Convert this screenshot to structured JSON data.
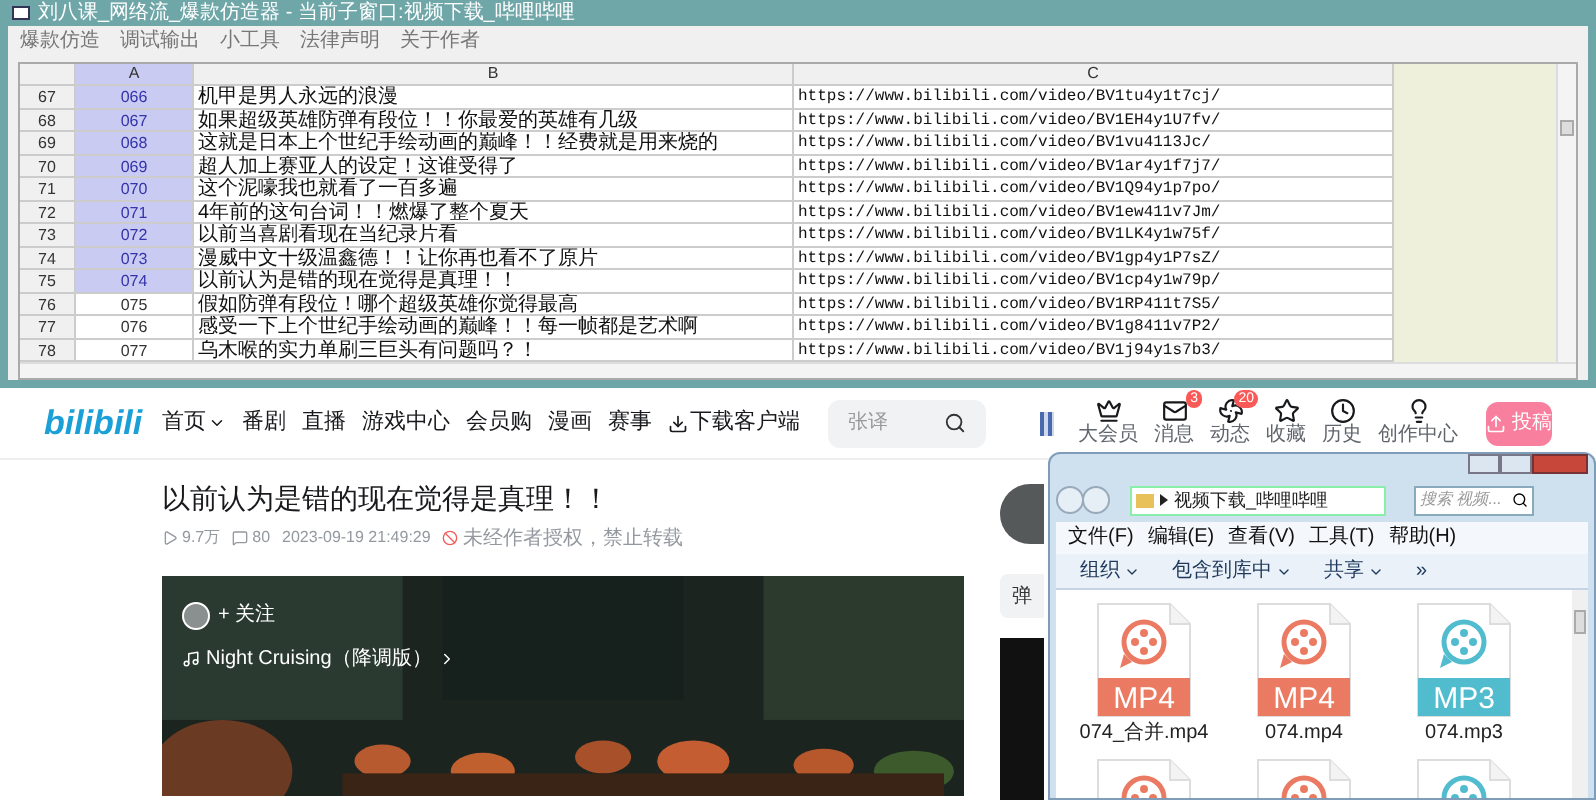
{
  "app": {
    "title": "刘八课_网络流_爆款仿造器 - 当前子窗口:视频下载_哔哩哔哩",
    "menu": [
      "爆款仿造",
      "调试输出",
      "小工具",
      "法律声明",
      "关于作者"
    ],
    "sheet": {
      "columns": [
        {
          "label": "A",
          "selected": true
        },
        {
          "label": "B",
          "selected": false
        },
        {
          "label": "C",
          "selected": false
        }
      ],
      "rows": [
        {
          "number": "67",
          "a": "066",
          "b": "机甲是男人永远的浪漫",
          "c": "https://www.bilibili.com/video/BV1tu4y1t7cj/",
          "selected": true
        },
        {
          "number": "68",
          "a": "067",
          "b": "如果超级英雄防弹有段位！！你最爱的英雄有几级",
          "c": "https://www.bilibili.com/video/BV1EH4y1U7fv/",
          "selected": true
        },
        {
          "number": "69",
          "a": "068",
          "b": "这就是日本上个世纪手绘动画的巅峰！！经费就是用来烧的",
          "c": "https://www.bilibili.com/video/BV1vu4113Jc/",
          "selected": true
        },
        {
          "number": "70",
          "a": "069",
          "b": "超人加上赛亚人的设定！这谁受得了",
          "c": "https://www.bilibili.com/video/BV1ar4y1f7j7/",
          "selected": true
        },
        {
          "number": "71",
          "a": "070",
          "b": "这个泥嚎我也就看了一百多遍",
          "c": "https://www.bilibili.com/video/BV1Q94y1p7po/",
          "selected": true
        },
        {
          "number": "72",
          "a": "071",
          "b": "4年前的这句台词！！燃爆了整个夏天",
          "c": "https://www.bilibili.com/video/BV1ew411v7Jm/",
          "selected": true
        },
        {
          "number": "73",
          "a": "072",
          "b": "以前当喜剧看现在当纪录片看",
          "c": "https://www.bilibili.com/video/BV1LK4y1w75f/",
          "selected": true
        },
        {
          "number": "74",
          "a": "073",
          "b": "漫威中文十级温鑫德！！让你再也看不了原片",
          "c": "https://www.bilibili.com/video/BV1gp4y1P7sZ/",
          "selected": true
        },
        {
          "number": "75",
          "a": "074",
          "b": "以前认为是错的现在觉得是真理！！",
          "c": "https://www.bilibili.com/video/BV1cp4y1w79p/",
          "selected": true
        },
        {
          "number": "76",
          "a": "075",
          "b": "假如防弹有段位！哪个超级英雄你觉得最高",
          "c": "https://www.bilibili.com/video/BV1RP411t7S5/",
          "selected": false
        },
        {
          "number": "77",
          "a": "076",
          "b": "感受一下上个世纪手绘动画的巅峰！！每一帧都是艺术啊",
          "c": "https://www.bilibili.com/video/BV1g8411v7P2/",
          "selected": false
        },
        {
          "number": "78",
          "a": "077",
          "b": "乌木喉的实力单刷三巨头有问题吗？！",
          "c": "https://www.bilibili.com/video/BV1j94y1s7b3/",
          "selected": false
        }
      ]
    }
  },
  "browser": {
    "logo": "bilibili",
    "nav": [
      {
        "label": "首页",
        "kind": "dropdown"
      },
      {
        "label": "番剧",
        "kind": "link"
      },
      {
        "label": "直播",
        "kind": "link"
      },
      {
        "label": "游戏中心",
        "kind": "link"
      },
      {
        "label": "会员购",
        "kind": "link"
      },
      {
        "label": "漫画",
        "kind": "link"
      },
      {
        "label": "赛事",
        "kind": "link"
      },
      {
        "label": "下载客户端",
        "kind": "download"
      }
    ],
    "search": {
      "placeholder": "张译"
    },
    "actions": [
      {
        "label": "大会员",
        "kind": "vip"
      },
      {
        "label": "消息",
        "kind": "mail",
        "badge": "3"
      },
      {
        "label": "动态",
        "kind": "fan",
        "badge": "20"
      },
      {
        "label": "收藏",
        "kind": "star"
      },
      {
        "label": "历史",
        "kind": "clock"
      },
      {
        "label": "创作中心",
        "kind": "bulb"
      }
    ],
    "upload_button": "投稿",
    "video": {
      "title": "以前认为是错的现在觉得是真理！！",
      "views": "9.7万",
      "comments": "80",
      "date": "2023-09-19 21:49:29",
      "notice": "未经作者授权，禁止转载",
      "follow": "+ 关注",
      "music": "Night Cruising（降调版）"
    },
    "danmaku_label": "弹"
  },
  "explorer": {
    "address": "视频下载_哔哩哔哩",
    "search": {
      "placeholder": "搜索 视频..."
    },
    "menu": [
      "文件(F)",
      "编辑(E)",
      "查看(V)",
      "工具(T)",
      "帮助(H)"
    ],
    "toolbar": [
      "组织",
      "包含到库中",
      "共享"
    ],
    "more": "»",
    "files": [
      {
        "name": "074_合并.mp4",
        "kind": "mp4",
        "type": "MP4"
      },
      {
        "name": "074.mp4",
        "kind": "mp4",
        "type": "MP4"
      },
      {
        "name": "074.mp3",
        "kind": "mp3",
        "type": "MP3"
      },
      {
        "kind": "mp4"
      },
      {
        "kind": "mp4"
      },
      {
        "kind": "mp3"
      }
    ]
  }
}
